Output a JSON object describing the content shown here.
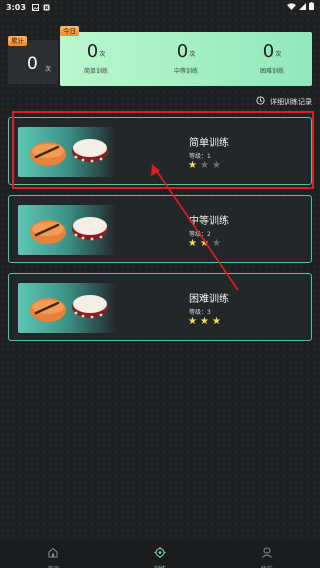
{
  "status_bar": {
    "time": "3:03"
  },
  "stats": {
    "total_tag": "累计",
    "total_value": "0",
    "total_unit": "次",
    "today_tag": "今日",
    "today_columns": [
      {
        "value": "0",
        "unit": "次",
        "label": "简单训练"
      },
      {
        "value": "0",
        "unit": "次",
        "label": "中等训练"
      },
      {
        "value": "0",
        "unit": "次",
        "label": "困难训练"
      }
    ]
  },
  "history_link": "详细训练记录",
  "cards": [
    {
      "title": "简单训练",
      "level": "等级：1",
      "stars": 1
    },
    {
      "title": "中等训练",
      "level": "等级：2",
      "stars": 2
    },
    {
      "title": "困难训练",
      "level": "等级：3",
      "stars": 3
    }
  ],
  "tabbar": {
    "items": [
      {
        "label": "首页",
        "icon": "home-icon"
      },
      {
        "label": "训练",
        "icon": "crosshair-icon"
      },
      {
        "label": "我的",
        "icon": "profile-icon"
      }
    ],
    "active": 1
  },
  "colors": {
    "accent": "#4ec79a",
    "today_bg": "#aaf2c6",
    "tag_orange": "#f08a2a",
    "star_active": "#f6e05a",
    "annotation_red": "#e21b22"
  }
}
